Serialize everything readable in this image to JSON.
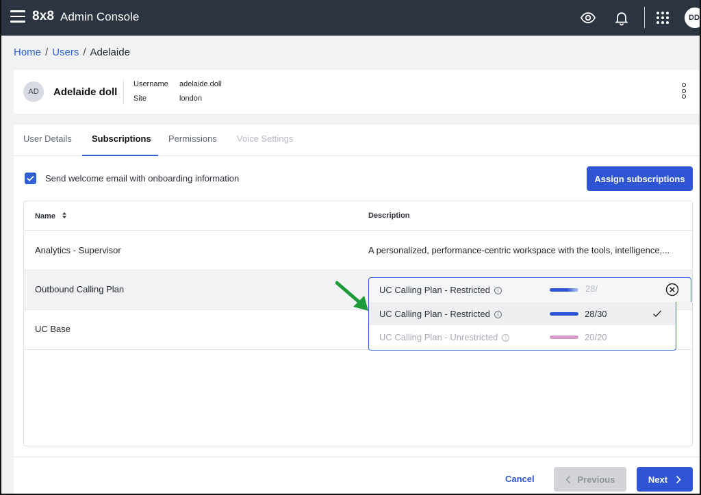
{
  "topbar": {
    "brand": "8x8",
    "title": "Admin Console",
    "avatar_initials": "DD"
  },
  "breadcrumb": {
    "items": [
      "Home",
      "Users",
      "Adelaide"
    ]
  },
  "user": {
    "initials": "AD",
    "name": "Adelaide doll",
    "username_label": "Username",
    "username": "adelaide.doll",
    "site_label": "Site",
    "site": "london"
  },
  "tabs": [
    "User Details",
    "Subscriptions",
    "Permissions",
    "Voice Settings"
  ],
  "active_tab": "Subscriptions",
  "welcome_email": {
    "label": "Send welcome email with onboarding information",
    "checked": true
  },
  "assign_button": "Assign subscriptions",
  "table": {
    "columns": [
      "Name",
      "Description"
    ],
    "rows": [
      {
        "name": "Analytics - Supervisor",
        "description": "A personalized, performance-centric workspace with the tools, intelligence,..."
      },
      {
        "name": "Outbound Calling Plan",
        "description": ""
      },
      {
        "name": "UC Base",
        "description": ""
      }
    ]
  },
  "select": {
    "value": "UC Calling Plan - Restricted",
    "count_partial": "28/"
  },
  "dropdown_options": [
    {
      "label": "UC Calling Plan - Restricted",
      "count": "28/30",
      "usage": 0.93,
      "selected": true,
      "disabled": false
    },
    {
      "label": "UC Calling Plan - Unrestricted",
      "count": "20/20",
      "usage": 1.0,
      "selected": false,
      "disabled": true
    }
  ],
  "colors": {
    "accent": "#2f55d4",
    "topbar": "#2b3440",
    "bar_restricted": "#2f55d4",
    "bar_unrestricted": "#d89ac8",
    "arrow": "#1f9a3a"
  },
  "footer": {
    "cancel": "Cancel",
    "previous": "Previous",
    "next": "Next"
  }
}
